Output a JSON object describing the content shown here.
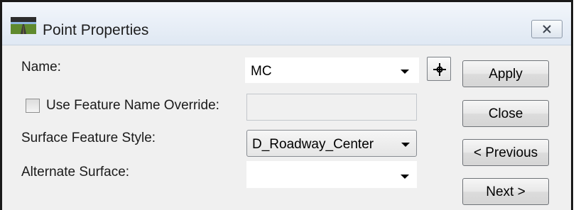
{
  "window": {
    "title": "Point Properties",
    "app_icon": "roadway-icon",
    "close_icon": "close-icon"
  },
  "form": {
    "name_label": "Name:",
    "name_value": "MC",
    "pick_icon": "crosshair-icon",
    "override_label": "Use Feature Name Override:",
    "override_checked": false,
    "override_value": "",
    "style_label": "Surface Feature Style:",
    "style_value": "D_Roadway_Center",
    "alt_surface_label": "Alternate Surface:",
    "alt_surface_value": ""
  },
  "buttons": {
    "apply": "Apply",
    "close": "Close",
    "previous": "< Previous",
    "next": "Next >"
  }
}
